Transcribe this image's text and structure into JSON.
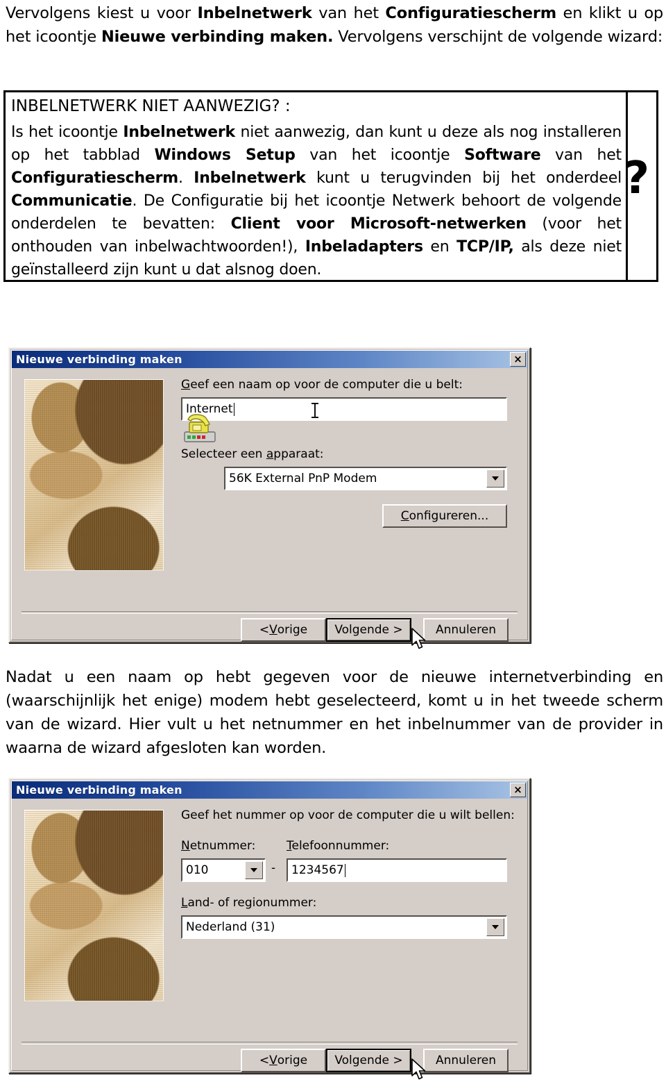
{
  "intro_paragraph": {
    "segments": [
      {
        "t": "Vervolgens kiest u voor ",
        "b": false
      },
      {
        "t": "Inbelnetwerk",
        "b": true
      },
      {
        "t": " van het ",
        "b": false
      },
      {
        "t": "Configuratiescherm",
        "b": true
      },
      {
        "t": " en klikt u op het icoontje ",
        "b": false
      },
      {
        "t": "Nieuwe verbinding maken.",
        "b": true
      },
      {
        "t": " Vervolgens verschijnt de volgende wizard:",
        "b": false
      }
    ]
  },
  "note": {
    "title": "INBELNETWERK NIET AANWEZIG? :",
    "marker": "?",
    "segments": [
      {
        "t": "Is het icoontje ",
        "b": false
      },
      {
        "t": "Inbelnetwerk",
        "b": true
      },
      {
        "t": " niet aanwezig, dan kunt u deze als nog installeren op het tabblad ",
        "b": false
      },
      {
        "t": "Windows Setup",
        "b": true
      },
      {
        "t": " van het icoontje ",
        "b": false
      },
      {
        "t": "Software",
        "b": true
      },
      {
        "t": " van het ",
        "b": false
      },
      {
        "t": "Configuratiescherm",
        "b": true
      },
      {
        "t": ". ",
        "b": false
      },
      {
        "t": "Inbelnetwerk",
        "b": true
      },
      {
        "t": " kunt u terugvinden bij het onderdeel ",
        "b": false
      },
      {
        "t": "Communicatie",
        "b": true
      },
      {
        "t": ". De Configuratie bij het icoontje Netwerk behoort de volgende onderdelen te bevatten: ",
        "b": false
      },
      {
        "t": "Client voor Microsoft-netwerken",
        "b": true
      },
      {
        "t": " (voor het onthouden van inbelwachtwoorden!), ",
        "b": false
      },
      {
        "t": "Inbeladapters",
        "b": true
      },
      {
        "t": " en ",
        "b": false
      },
      {
        "t": "TCP/IP,",
        "b": true
      },
      {
        "t": " als deze niet geïnstalleerd zijn kunt u dat alsnog doen.",
        "b": false
      }
    ]
  },
  "mid_paragraph": {
    "segments": [
      {
        "t": "Nadat u een naam op hebt gegeven voor de nieuwe internetverbinding en (waarschijnlijk het enige) modem hebt geselecteerd, komt u in het tweede scherm van de wizard. Hier vult u het netnummer en het inbelnummer van de provider in waarna de wizard afgesloten kan worden.",
        "b": false
      }
    ]
  },
  "dialog_one": {
    "title": "Nieuwe verbinding maken",
    "close_label": "×",
    "close_icon": "close-icon",
    "image_alt": "modem-photo",
    "label_name": "Geef een naam op voor de computer die u belt:",
    "label_name_accel": "G",
    "name_value": "Internet",
    "label_device": "Selecteer een apparaat:",
    "label_device_accel": "a",
    "device_icon": "telephone-modem-icon",
    "device_value": "56K External PnP Modem",
    "configure_label": "Configureren...",
    "configure_accel": "C",
    "buttons": {
      "back": "< Vorige",
      "back_accel": "V",
      "next": "Volgende >",
      "cancel": "Annuleren"
    }
  },
  "dialog_two": {
    "title": "Nieuwe verbinding maken",
    "close_label": "×",
    "close_icon": "close-icon",
    "image_alt": "modem-photo",
    "label_head": "Geef het nummer op voor de computer die u wilt bellen:",
    "label_areacode": "Netnummer:",
    "label_areacode_accel": "N",
    "areacode_value": "010",
    "separator_dash": "-",
    "label_phone": "Telefoonnummer:",
    "label_phone_accel": "T",
    "phone_value": "1234567",
    "label_country": "Land- of regionummer:",
    "label_country_accel": "L",
    "country_value": "Nederland (31)",
    "buttons": {
      "back": "< Vorige",
      "back_accel": "V",
      "next": "Volgende >",
      "cancel": "Annuleren"
    }
  },
  "colors": {
    "dialog_face": "#d4cdc8",
    "titlebar_start": "#0b2d7a",
    "titlebar_end": "#a8c3e4",
    "field_bg": "#ffffff",
    "text": "#000000"
  }
}
